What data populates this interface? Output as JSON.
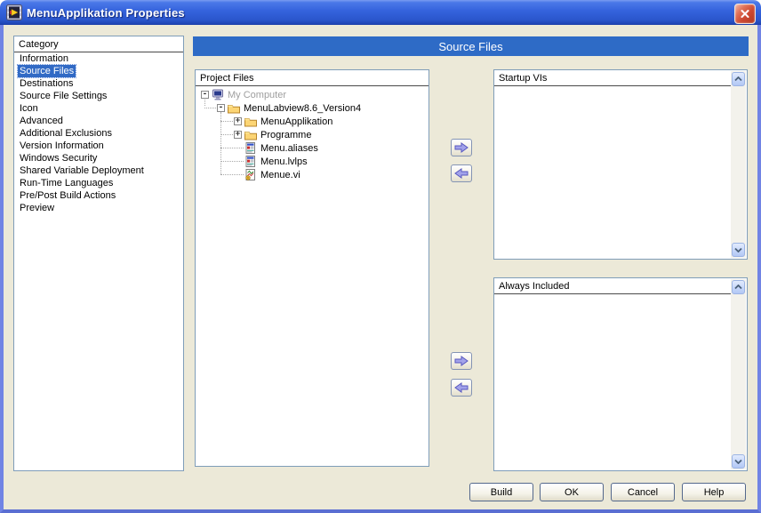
{
  "colors": {
    "titlebar_blue": "#3462dc",
    "dialog_background": "#ece9d8",
    "dialog_border_blue": "#7184e4",
    "section_header_blue": "#2e6bc6",
    "selection_blue": "#316ac5",
    "panel_border": "#7f9db9",
    "folder_yellow": "#fcd575",
    "arrow_lavender": "#a2a2ea",
    "close_button_red": "#cc4830"
  },
  "window": {
    "title": "MenuApplikation Properties"
  },
  "category_panel": {
    "header": "Category",
    "items": [
      {
        "label": "Information"
      },
      {
        "label": "Source Files",
        "selected": true
      },
      {
        "label": "Destinations"
      },
      {
        "label": "Source File Settings"
      },
      {
        "label": "Icon"
      },
      {
        "label": "Advanced"
      },
      {
        "label": "Additional Exclusions"
      },
      {
        "label": "Version Information"
      },
      {
        "label": "Windows Security"
      },
      {
        "label": "Shared Variable Deployment"
      },
      {
        "label": "Run-Time Languages"
      },
      {
        "label": "Pre/Post Build Actions"
      },
      {
        "label": "Preview"
      }
    ]
  },
  "content": {
    "section_header": "Source Files",
    "project_files": {
      "header": "Project Files",
      "tree": [
        {
          "label": "My Computer",
          "level": 0,
          "expander": "-",
          "icon": "computer-icon",
          "dimmed": true
        },
        {
          "label": "MenuLabview8.6_Version4",
          "level": 1,
          "expander": "-",
          "icon": "folder-icon"
        },
        {
          "label": "MenuApplikation",
          "level": 2,
          "expander": "+",
          "icon": "folder-icon"
        },
        {
          "label": "Programme",
          "level": 2,
          "expander": "+",
          "icon": "folder-icon"
        },
        {
          "label": "Menu.aliases",
          "level": 2,
          "expander": "",
          "icon": "config-file-icon"
        },
        {
          "label": "Menu.lvlps",
          "level": 2,
          "expander": "",
          "icon": "config-file-icon"
        },
        {
          "label": "Menue.vi",
          "level": 2,
          "expander": "",
          "icon": "vi-file-icon"
        }
      ]
    },
    "startup_vis": {
      "header": "Startup VIs",
      "items": []
    },
    "always_included": {
      "header": "Always Included",
      "items": []
    }
  },
  "footer_buttons": [
    {
      "label": "Build"
    },
    {
      "label": "OK"
    },
    {
      "label": "Cancel"
    },
    {
      "label": "Help"
    }
  ],
  "icons": {
    "close": "×",
    "move_right": "→",
    "move_left": "←",
    "scroll_up": "▲",
    "scroll_down": "▼",
    "expander_expanded": "-",
    "expander_collapsed": "+"
  }
}
